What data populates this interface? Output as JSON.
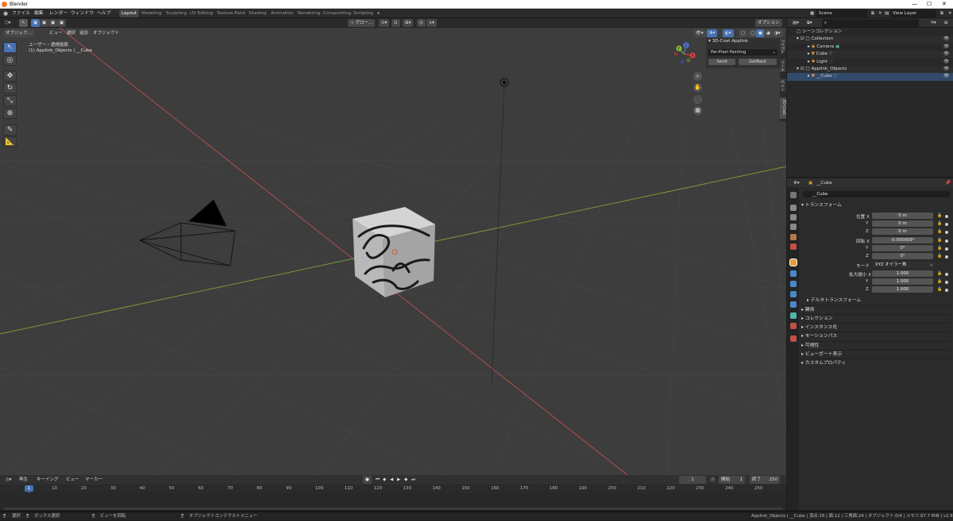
{
  "window": {
    "title": "Blender",
    "controls": [
      "—",
      "☐",
      "✕"
    ]
  },
  "menu": [
    "ファイル",
    "編集",
    "レンダー",
    "ウィンドウ",
    "ヘルプ"
  ],
  "workspaces": [
    "Layout",
    "Modeling",
    "Sculpting",
    "UV Editing",
    "Texture Paint",
    "Shading",
    "Animation",
    "Rendering",
    "Compositing",
    "Scripting",
    "+"
  ],
  "scene": {
    "name": "Scene",
    "view_layer": "View Layer"
  },
  "viewport_header": {
    "mode": "オブジェク...",
    "menus": [
      "ビュー",
      "選択",
      "追加",
      "オブジェクト"
    ],
    "orientation": "グロー...",
    "options": "オプション"
  },
  "viewport_overlay": {
    "view_name": "ユーザー・透視投影",
    "context": "(1) Applink_Objects | __Cube"
  },
  "npanel": {
    "title": "3D-Coat Applink",
    "dropdown": "Per-Pixel Painting",
    "send": "Send",
    "getback": "GetBack",
    "tabs": [
      "アイテム",
      "ツール",
      "ビュー",
      "3D-Coat"
    ]
  },
  "gizmo": {
    "x": "X",
    "y": "Y",
    "z": "Z"
  },
  "outliner": {
    "search_placeholder": "",
    "rows": [
      {
        "label": "シーンコレクション",
        "indent": 0
      },
      {
        "label": "Collection",
        "indent": 1
      },
      {
        "label": "Camera",
        "indent": 2
      },
      {
        "label": "Cube",
        "indent": 2
      },
      {
        "label": "Light",
        "indent": 2
      },
      {
        "label": "Applink_Objects",
        "indent": 1
      },
      {
        "label": "__Cube",
        "indent": 2
      }
    ]
  },
  "properties": {
    "object_name_header": "__Cube",
    "object_name_field": "__Cube",
    "transform_title": "トランスフォーム",
    "location": {
      "label": "位置 X",
      "x": "0 m",
      "y": "0 m",
      "z": "0 m"
    },
    "rotation": {
      "label": "回転 X",
      "x": "-0.000009°",
      "y": "0°",
      "z": "0°"
    },
    "mode_label": "モード",
    "mode_value": "XYZ オイラー角",
    "scale": {
      "label": "拡大縮小 X",
      "x": "1.000",
      "y": "1.000",
      "z": "1.000"
    },
    "axis_y": "Y",
    "axis_z": "Z",
    "delta_transform": "デルタトランスフォーム",
    "sections": [
      "関係",
      "コレクション",
      "インスタンス化",
      "モーションパス",
      "可視性",
      "ビューポート表示",
      "カスタムプロパティ"
    ]
  },
  "timeline": {
    "menus": [
      "再生",
      "キーイング",
      "ビュー",
      "マーカー"
    ],
    "current_frame": "1",
    "start_label": "開始",
    "start": "1",
    "end_label": "終了",
    "end": "250",
    "ticks": [
      "1",
      "10",
      "20",
      "30",
      "40",
      "50",
      "60",
      "70",
      "80",
      "90",
      "100",
      "110",
      "120",
      "130",
      "140",
      "150",
      "160",
      "170",
      "180",
      "190",
      "200",
      "210",
      "220",
      "230",
      "240",
      "250"
    ]
  },
  "statusbar": {
    "select": "選択",
    "box_select": "ボックス選択",
    "rotate_view": "ビューを回転",
    "context_menu": "オブジェクトコンテクストメニュー",
    "stats": "Applink_Objects | __Cube | 頂点:16 | 面:12 | 三角面:24 | オブジェクト:0/4 | メモリ:67.7 MiB | v2.81.16"
  }
}
